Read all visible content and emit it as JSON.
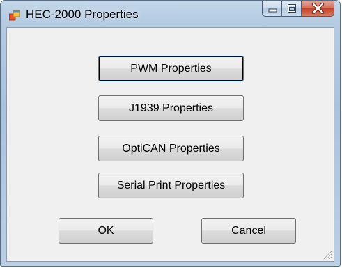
{
  "window": {
    "title": "HEC-2000 Properties",
    "icon": "windows-form-icon"
  },
  "caption": {
    "minimize_icon": "minimize-icon",
    "maximize_icon": "maximize-icon",
    "close_icon": "close-icon"
  },
  "buttons": {
    "pwm": "PWM Properties",
    "j1939": "J1939 Properties",
    "optican": "OptiCAN Properties",
    "serial_print": "Serial Print Properties",
    "ok": "OK",
    "cancel": "Cancel"
  },
  "colors": {
    "close_button": "#c4402a",
    "default_button_border": "#3c7fb1",
    "client_background": "#f0f0f0"
  }
}
